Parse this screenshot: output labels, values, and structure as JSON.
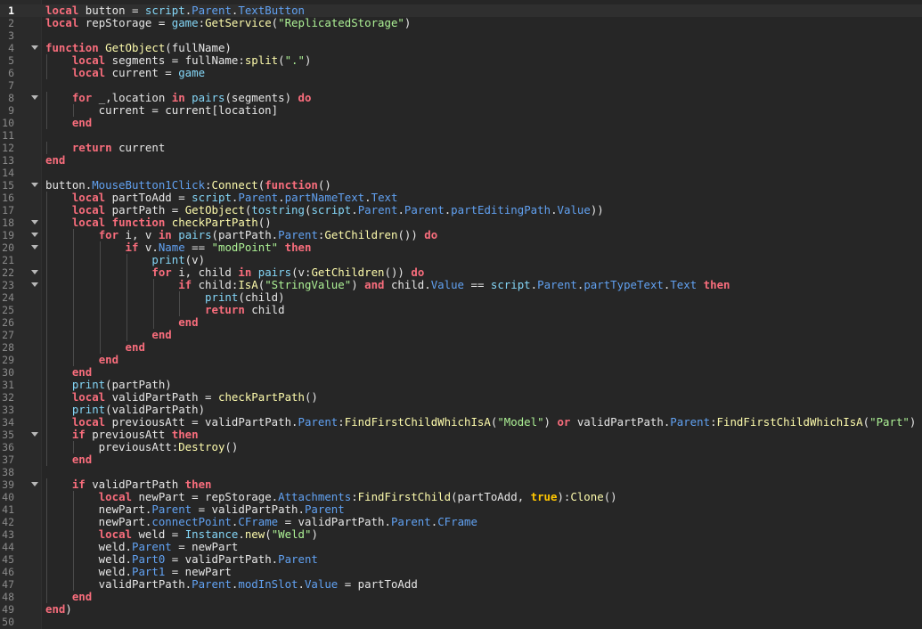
{
  "editor": {
    "fold_lines": [
      4,
      8,
      15,
      18,
      19,
      20,
      22,
      23,
      35,
      39
    ],
    "active_line": 1,
    "lines": [
      [
        [
          "local",
          "kw"
        ],
        [
          " button = ",
          "id"
        ],
        [
          "script",
          "bi"
        ],
        [
          ".",
          "id"
        ],
        [
          "Parent",
          "pr"
        ],
        [
          ".",
          "id"
        ],
        [
          "TextButton",
          "pr"
        ]
      ],
      [
        [
          "local",
          "kw"
        ],
        [
          " repStorage = ",
          "id"
        ],
        [
          "game",
          "bi"
        ],
        [
          ":",
          "id"
        ],
        [
          "GetService",
          "fn"
        ],
        [
          "(",
          "id"
        ],
        [
          "\"ReplicatedStorage\"",
          "st"
        ],
        [
          ")",
          "id"
        ]
      ],
      [],
      [
        [
          "function",
          "kw"
        ],
        [
          " ",
          "id"
        ],
        [
          "GetObject",
          "fn"
        ],
        [
          "(fullName)",
          "id"
        ]
      ],
      [
        [
          "    ",
          "id"
        ],
        [
          "local",
          "kw"
        ],
        [
          " segments = fullName:",
          "id"
        ],
        [
          "split",
          "fn"
        ],
        [
          "(",
          "id"
        ],
        [
          "\".\"",
          "st"
        ],
        [
          ")",
          "id"
        ]
      ],
      [
        [
          "    ",
          "id"
        ],
        [
          "local",
          "kw"
        ],
        [
          " current = ",
          "id"
        ],
        [
          "game",
          "bi"
        ]
      ],
      [],
      [
        [
          "    ",
          "id"
        ],
        [
          "for",
          "kw"
        ],
        [
          " _,location ",
          "id"
        ],
        [
          "in",
          "kw"
        ],
        [
          " ",
          "id"
        ],
        [
          "pairs",
          "bi"
        ],
        [
          "(segments) ",
          "id"
        ],
        [
          "do",
          "kw"
        ]
      ],
      [
        [
          "        current = current[location]",
          "id"
        ]
      ],
      [
        [
          "    ",
          "id"
        ],
        [
          "end",
          "kw"
        ]
      ],
      [],
      [
        [
          "    ",
          "id"
        ],
        [
          "return",
          "kw"
        ],
        [
          " current",
          "id"
        ]
      ],
      [
        [
          "end",
          "kw"
        ]
      ],
      [],
      [
        [
          "button.",
          "id"
        ],
        [
          "MouseButton1Click",
          "pr"
        ],
        [
          ":",
          "id"
        ],
        [
          "Connect",
          "fn"
        ],
        [
          "(",
          "id"
        ],
        [
          "function",
          "kw"
        ],
        [
          "()",
          "id"
        ]
      ],
      [
        [
          "    ",
          "id"
        ],
        [
          "local",
          "kw"
        ],
        [
          " partToAdd = ",
          "id"
        ],
        [
          "script",
          "bi"
        ],
        [
          ".",
          "id"
        ],
        [
          "Parent",
          "pr"
        ],
        [
          ".",
          "id"
        ],
        [
          "partNameText",
          "pr"
        ],
        [
          ".",
          "id"
        ],
        [
          "Text",
          "pr"
        ]
      ],
      [
        [
          "    ",
          "id"
        ],
        [
          "local",
          "kw"
        ],
        [
          " partPath = ",
          "id"
        ],
        [
          "GetObject",
          "fn"
        ],
        [
          "(",
          "id"
        ],
        [
          "tostring",
          "bi"
        ],
        [
          "(",
          "id"
        ],
        [
          "script",
          "bi"
        ],
        [
          ".",
          "id"
        ],
        [
          "Parent",
          "pr"
        ],
        [
          ".",
          "id"
        ],
        [
          "Parent",
          "pr"
        ],
        [
          ".",
          "id"
        ],
        [
          "partEditingPath",
          "pr"
        ],
        [
          ".",
          "id"
        ],
        [
          "Value",
          "pr"
        ],
        [
          "))",
          "id"
        ]
      ],
      [
        [
          "    ",
          "id"
        ],
        [
          "local",
          "kw"
        ],
        [
          " ",
          "id"
        ],
        [
          "function",
          "kw"
        ],
        [
          " ",
          "id"
        ],
        [
          "checkPartPath",
          "fn"
        ],
        [
          "()",
          "id"
        ]
      ],
      [
        [
          "        ",
          "id"
        ],
        [
          "for",
          "kw"
        ],
        [
          " i, v ",
          "id"
        ],
        [
          "in",
          "kw"
        ],
        [
          " ",
          "id"
        ],
        [
          "pairs",
          "bi"
        ],
        [
          "(partPath.",
          "id"
        ],
        [
          "Parent",
          "pr"
        ],
        [
          ":",
          "id"
        ],
        [
          "GetChildren",
          "fn"
        ],
        [
          "()) ",
          "id"
        ],
        [
          "do",
          "kw"
        ]
      ],
      [
        [
          "            ",
          "id"
        ],
        [
          "if",
          "kw"
        ],
        [
          " v.",
          "id"
        ],
        [
          "Name",
          "pr"
        ],
        [
          " == ",
          "id"
        ],
        [
          "\"modPoint\"",
          "st"
        ],
        [
          " ",
          "id"
        ],
        [
          "then",
          "kw"
        ]
      ],
      [
        [
          "                ",
          "id"
        ],
        [
          "print",
          "bi"
        ],
        [
          "(v)",
          "id"
        ]
      ],
      [
        [
          "                ",
          "id"
        ],
        [
          "for",
          "kw"
        ],
        [
          " i, child ",
          "id"
        ],
        [
          "in",
          "kw"
        ],
        [
          " ",
          "id"
        ],
        [
          "pairs",
          "bi"
        ],
        [
          "(v:",
          "id"
        ],
        [
          "GetChildren",
          "fn"
        ],
        [
          "()) ",
          "id"
        ],
        [
          "do",
          "kw"
        ]
      ],
      [
        [
          "                    ",
          "id"
        ],
        [
          "if",
          "kw"
        ],
        [
          " child:",
          "id"
        ],
        [
          "IsA",
          "fn"
        ],
        [
          "(",
          "id"
        ],
        [
          "\"StringValue\"",
          "st"
        ],
        [
          ") ",
          "id"
        ],
        [
          "and",
          "kw"
        ],
        [
          " child.",
          "id"
        ],
        [
          "Value",
          "pr"
        ],
        [
          " == ",
          "id"
        ],
        [
          "script",
          "bi"
        ],
        [
          ".",
          "id"
        ],
        [
          "Parent",
          "pr"
        ],
        [
          ".",
          "id"
        ],
        [
          "partTypeText",
          "pr"
        ],
        [
          ".",
          "id"
        ],
        [
          "Text",
          "pr"
        ],
        [
          " ",
          "id"
        ],
        [
          "then",
          "kw"
        ]
      ],
      [
        [
          "                        ",
          "id"
        ],
        [
          "print",
          "bi"
        ],
        [
          "(child)",
          "id"
        ]
      ],
      [
        [
          "                        ",
          "id"
        ],
        [
          "return",
          "kw"
        ],
        [
          " child",
          "id"
        ]
      ],
      [
        [
          "                    ",
          "id"
        ],
        [
          "end",
          "kw"
        ]
      ],
      [
        [
          "                ",
          "id"
        ],
        [
          "end",
          "kw"
        ]
      ],
      [
        [
          "            ",
          "id"
        ],
        [
          "end",
          "kw"
        ]
      ],
      [
        [
          "        ",
          "id"
        ],
        [
          "end",
          "kw"
        ]
      ],
      [
        [
          "    ",
          "id"
        ],
        [
          "end",
          "kw"
        ]
      ],
      [
        [
          "    ",
          "id"
        ],
        [
          "print",
          "bi"
        ],
        [
          "(partPath)",
          "id"
        ]
      ],
      [
        [
          "    ",
          "id"
        ],
        [
          "local",
          "kw"
        ],
        [
          " validPartPath = ",
          "id"
        ],
        [
          "checkPartPath",
          "fn"
        ],
        [
          "()",
          "id"
        ]
      ],
      [
        [
          "    ",
          "id"
        ],
        [
          "print",
          "bi"
        ],
        [
          "(validPartPath)",
          "id"
        ]
      ],
      [
        [
          "    ",
          "id"
        ],
        [
          "local",
          "kw"
        ],
        [
          " previousAtt = validPartPath.",
          "id"
        ],
        [
          "Parent",
          "pr"
        ],
        [
          ":",
          "id"
        ],
        [
          "FindFirstChildWhichIsA",
          "fn"
        ],
        [
          "(",
          "id"
        ],
        [
          "\"Model\"",
          "st"
        ],
        [
          ") ",
          "id"
        ],
        [
          "or",
          "kw"
        ],
        [
          " validPartPath.",
          "id"
        ],
        [
          "Parent",
          "pr"
        ],
        [
          ":",
          "id"
        ],
        [
          "FindFirstChildWhichIsA",
          "fn"
        ],
        [
          "(",
          "id"
        ],
        [
          "\"Part\"",
          "st"
        ],
        [
          ")",
          "id"
        ]
      ],
      [
        [
          "    ",
          "id"
        ],
        [
          "if",
          "kw"
        ],
        [
          " previousAtt ",
          "id"
        ],
        [
          "then",
          "kw"
        ]
      ],
      [
        [
          "        previousAtt:",
          "id"
        ],
        [
          "Destroy",
          "fn"
        ],
        [
          "()",
          "id"
        ]
      ],
      [
        [
          "    ",
          "id"
        ],
        [
          "end",
          "kw"
        ]
      ],
      [],
      [
        [
          "    ",
          "id"
        ],
        [
          "if",
          "kw"
        ],
        [
          " validPartPath ",
          "id"
        ],
        [
          "then",
          "kw"
        ]
      ],
      [
        [
          "        ",
          "id"
        ],
        [
          "local",
          "kw"
        ],
        [
          " newPart = repStorage.",
          "id"
        ],
        [
          "Attachments",
          "pr"
        ],
        [
          ":",
          "id"
        ],
        [
          "FindFirstChild",
          "fn"
        ],
        [
          "(partToAdd, ",
          "id"
        ],
        [
          "true",
          "bl"
        ],
        [
          "):",
          "id"
        ],
        [
          "Clone",
          "fn"
        ],
        [
          "()",
          "id"
        ]
      ],
      [
        [
          "        newPart.",
          "id"
        ],
        [
          "Parent",
          "pr"
        ],
        [
          " = validPartPath.",
          "id"
        ],
        [
          "Parent",
          "pr"
        ]
      ],
      [
        [
          "        newPart.",
          "id"
        ],
        [
          "connectPoint",
          "pr"
        ],
        [
          ".",
          "id"
        ],
        [
          "CFrame",
          "pr"
        ],
        [
          " = validPartPath.",
          "id"
        ],
        [
          "Parent",
          "pr"
        ],
        [
          ".",
          "id"
        ],
        [
          "CFrame",
          "pr"
        ]
      ],
      [
        [
          "        ",
          "id"
        ],
        [
          "local",
          "kw"
        ],
        [
          " weld = ",
          "id"
        ],
        [
          "Instance",
          "bi"
        ],
        [
          ".",
          "id"
        ],
        [
          "new",
          "fn"
        ],
        [
          "(",
          "id"
        ],
        [
          "\"Weld\"",
          "st"
        ],
        [
          ")",
          "id"
        ]
      ],
      [
        [
          "        weld.",
          "id"
        ],
        [
          "Parent",
          "pr"
        ],
        [
          " = newPart",
          "id"
        ]
      ],
      [
        [
          "        weld.",
          "id"
        ],
        [
          "Part0",
          "pr"
        ],
        [
          " = validPartPath.",
          "id"
        ],
        [
          "Parent",
          "pr"
        ]
      ],
      [
        [
          "        weld.",
          "id"
        ],
        [
          "Part1",
          "pr"
        ],
        [
          " = newPart",
          "id"
        ]
      ],
      [
        [
          "        validPartPath.",
          "id"
        ],
        [
          "Parent",
          "pr"
        ],
        [
          ".",
          "id"
        ],
        [
          "modInSlot",
          "pr"
        ],
        [
          ".",
          "id"
        ],
        [
          "Value",
          "pr"
        ],
        [
          " = partToAdd",
          "id"
        ]
      ],
      [
        [
          "    ",
          "id"
        ],
        [
          "end",
          "kw"
        ]
      ],
      [
        [
          "end",
          "kw"
        ],
        [
          ")",
          "id"
        ]
      ],
      []
    ]
  }
}
